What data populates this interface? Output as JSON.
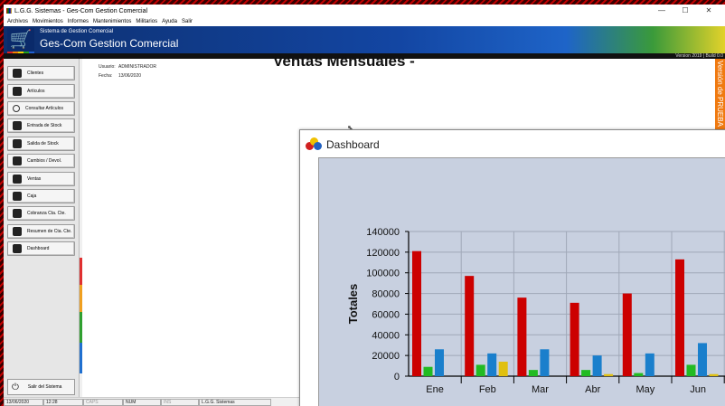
{
  "window": {
    "title": "L.G.G. Sistemas - Ges-Com Gestion Comercial",
    "controls": [
      "—",
      "☐",
      "✕"
    ]
  },
  "menu": [
    "Archivos",
    "Movimientos",
    "Informes",
    "Mantenimientos",
    "Militarios",
    "Ayuda",
    "Salir"
  ],
  "banner": {
    "subtitle": "Sistema de Gestion Comercial",
    "title": "Ges-Com Gestion Comercial",
    "version": "Version 2019 | Build 0.0"
  },
  "sidebar": {
    "items": [
      {
        "label": "Clientes",
        "icon": "clients-icon"
      },
      {
        "label": "Artículos",
        "icon": "articles-icon"
      },
      {
        "label": "Consultar Artículos",
        "icon": "search-icon"
      },
      {
        "label": "Entrada de Stock",
        "icon": "cart-in-icon"
      },
      {
        "label": "Salida de Stock",
        "icon": "cart-out-icon"
      },
      {
        "label": "Cambios / Devol.",
        "icon": "exchange-icon"
      },
      {
        "label": "Ventas",
        "icon": "sales-icon"
      },
      {
        "label": "Caja",
        "icon": "cash-register-icon"
      },
      {
        "label": "Cobranza Cta. Cte.",
        "icon": "collection-icon"
      },
      {
        "label": "Resumen de Cta. Cte.",
        "icon": "summary-icon"
      },
      {
        "label": "Dashboard",
        "icon": "bar-chart-icon"
      }
    ],
    "exit_label": "Salir del Sistema"
  },
  "user_info": {
    "user_label": "Usuario:",
    "user_value": "ADMINISTRADOR",
    "date_label": "Fecha:",
    "date_value": "13/06/2020"
  },
  "side_tab": "Versión de PRUEBA",
  "statusbar": {
    "date": "13/06/2020",
    "time": "12:28",
    "caps": "CAPS",
    "num": "NUM",
    "ins": "INS",
    "company": "L.G.G. Sistemas"
  },
  "dashboard": {
    "title": "Dashboard",
    "chart_title": "Ventas Mensuales -"
  },
  "colors": {
    "red": "#cc0000",
    "green": "#22bb22",
    "blue": "#1a7fcc",
    "yellow": "#e0c010"
  },
  "chart_data": {
    "type": "bar",
    "title": "Ventas Mensuales -",
    "ylabel": "Totales",
    "categories": [
      "Ene",
      "Feb",
      "Mar",
      "Abr",
      "May",
      "Jun"
    ],
    "ylim": [
      0,
      140000
    ],
    "yticks": [
      "140000",
      "120000",
      "100000",
      "80000",
      "60000",
      "40000",
      "20000",
      "0"
    ],
    "grid": true,
    "series": [
      {
        "color": "#cc0000",
        "values": [
          121000,
          97000,
          76000,
          71000,
          80000,
          113000
        ]
      },
      {
        "color": "#22bb22",
        "values": [
          9000,
          11000,
          6000,
          6000,
          3000,
          11000
        ]
      },
      {
        "color": "#1a7fcc",
        "values": [
          26000,
          22000,
          26000,
          20000,
          22000,
          32000
        ]
      },
      {
        "color": "#e0c010",
        "values": [
          0,
          14000,
          0,
          2000,
          0,
          2000
        ]
      }
    ]
  }
}
